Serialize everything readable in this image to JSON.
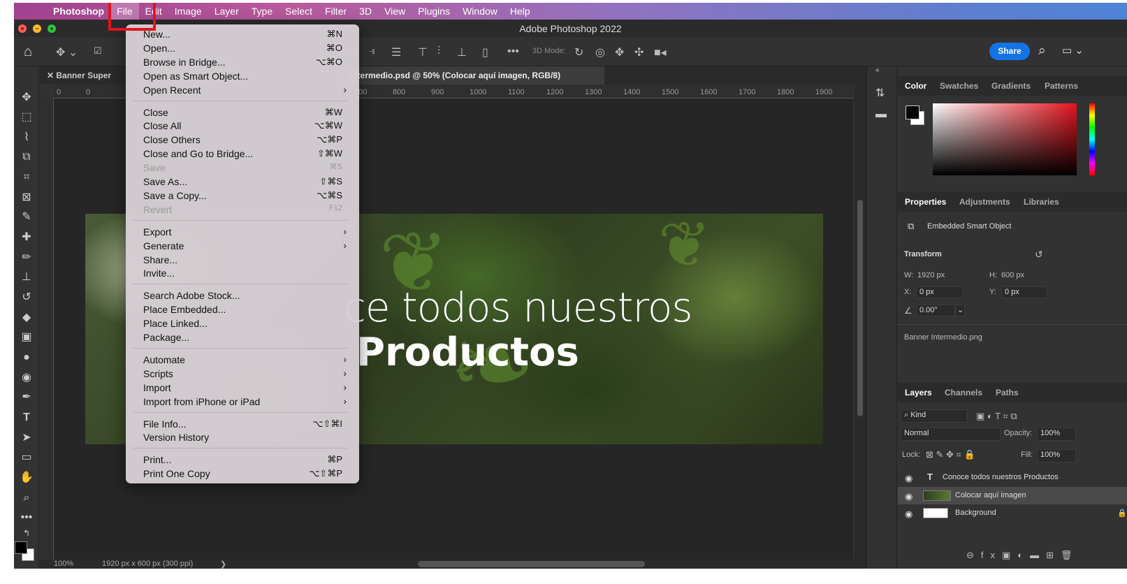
{
  "menubar": {
    "items": [
      "Photoshop",
      "File",
      "Edit",
      "Image",
      "Layer",
      "Type",
      "Select",
      "Filter",
      "3D",
      "View",
      "Plugins",
      "Window",
      "Help"
    ],
    "active": "File"
  },
  "window": {
    "title": "Adobe Photoshop 2022"
  },
  "options": {
    "mode_label": "3D Mode:",
    "share_label": "Share"
  },
  "doc_tabs": [
    "Banner Super",
    "intermedio.psd @ 50% (Colocar aquí imagen, RGB/8)"
  ],
  "ruler_ticks": [
    "0",
    "0",
    "700",
    "800",
    "900",
    "1000",
    "1100",
    "1200",
    "1300",
    "1400",
    "1500",
    "1600",
    "1700",
    "1800",
    "1900"
  ],
  "canvas": {
    "line1": "ce todos nuestros",
    "line2": "Productos"
  },
  "status": {
    "zoom": "100%",
    "doc_info": "1920 px x 600 px (300 ppi)",
    "arrow": "❯"
  },
  "file_menu": {
    "groups": [
      [
        {
          "label": "New...",
          "shortcut": "⌘N"
        },
        {
          "label": "Open...",
          "shortcut": "⌘O"
        },
        {
          "label": "Browse in Bridge...",
          "shortcut": "⌥⌘O"
        },
        {
          "label": "Open as Smart Object...",
          "shortcut": ""
        },
        {
          "label": "Open Recent",
          "shortcut": "",
          "submenu": true
        }
      ],
      [
        {
          "label": "Close",
          "shortcut": "⌘W"
        },
        {
          "label": "Close All",
          "shortcut": "⌥⌘W"
        },
        {
          "label": "Close Others",
          "shortcut": "⌥⌘P"
        },
        {
          "label": "Close and Go to Bridge...",
          "shortcut": "⇧⌘W"
        },
        {
          "label": "Save",
          "shortcut": "⌘S",
          "disabled": true
        },
        {
          "label": "Save As...",
          "shortcut": "⇧⌘S"
        },
        {
          "label": "Save a Copy...",
          "shortcut": "⌥⌘S"
        },
        {
          "label": "Revert",
          "shortcut": "F12",
          "disabled": true
        }
      ],
      [
        {
          "label": "Export",
          "shortcut": "",
          "submenu": true
        },
        {
          "label": "Generate",
          "shortcut": "",
          "submenu": true
        },
        {
          "label": "Share...",
          "shortcut": ""
        },
        {
          "label": "Invite...",
          "shortcut": ""
        }
      ],
      [
        {
          "label": "Search Adobe Stock...",
          "shortcut": ""
        },
        {
          "label": "Place Embedded...",
          "shortcut": ""
        },
        {
          "label": "Place Linked...",
          "shortcut": ""
        },
        {
          "label": "Package...",
          "shortcut": ""
        }
      ],
      [
        {
          "label": "Automate",
          "shortcut": "",
          "submenu": true
        },
        {
          "label": "Scripts",
          "shortcut": "",
          "submenu": true
        },
        {
          "label": "Import",
          "shortcut": "",
          "submenu": true
        },
        {
          "label": "Import from iPhone or iPad",
          "shortcut": "",
          "submenu": true
        }
      ],
      [
        {
          "label": "File Info...",
          "shortcut": "⌥⇧⌘I"
        },
        {
          "label": "Version History",
          "shortcut": ""
        }
      ],
      [
        {
          "label": "Print...",
          "shortcut": "⌘P"
        },
        {
          "label": "Print One Copy",
          "shortcut": "⌥⇧⌘P"
        }
      ]
    ]
  },
  "color_panel": {
    "tabs": [
      "Color",
      "Swatches",
      "Gradients",
      "Patterns"
    ]
  },
  "properties_panel": {
    "tabs": [
      "Properties",
      "Adjustments",
      "Libraries"
    ],
    "object_type": "Embedded Smart Object",
    "transform_label": "Transform",
    "w_label": "W:",
    "w": "1920 px",
    "h_label": "H:",
    "h": "600 px",
    "x_label": "X:",
    "x": "0 px",
    "y_label": "Y:",
    "y": "0 px",
    "angle": "0.00°",
    "filename": "Banner Intermedio.png"
  },
  "layers_panel": {
    "tabs": [
      "Layers",
      "Channels",
      "Paths"
    ],
    "kind": "Kind",
    "blend_mode": "Normal",
    "opacity_label": "Opacity:",
    "opacity": "100%",
    "lock_label": "Lock:",
    "fill_label": "Fill:",
    "fill": "100%",
    "layers": [
      "Conoce todos nuestros Productos",
      "Colocar aquí imagen",
      "Background"
    ]
  }
}
